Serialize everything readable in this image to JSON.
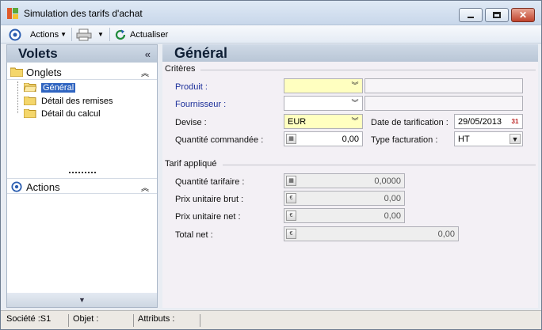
{
  "window": {
    "title": "Simulation des tarifs d'achat",
    "controls": [
      "minimize",
      "maximize",
      "close"
    ]
  },
  "toolbar": {
    "actions_label": "Actions",
    "refresh_label": "Actualiser"
  },
  "left_panel": {
    "title": "Volets",
    "onglets_header": "Onglets",
    "tree": [
      "Général",
      "Détail des remises",
      "Détail du calcul"
    ],
    "selected": "Général",
    "actions_header": "Actions"
  },
  "main": {
    "title": "Général",
    "criteres": {
      "label": "Critères",
      "produit_label": "Produit :",
      "produit_value": "",
      "fournisseur_label": "Fournisseur :",
      "fournisseur_value": "",
      "devise_label": "Devise :",
      "devise_value": "EUR",
      "date_label": "Date de tarification :",
      "date_value": "29/05/2013",
      "quantite_label": "Quantité commandée :",
      "quantite_value": "0,00",
      "type_label": "Type facturation :",
      "type_value": "HT"
    },
    "tarif": {
      "label": "Tarif appliqué",
      "qte_tarifaire_label": "Quantité tarifaire :",
      "qte_tarifaire_value": "0,0000",
      "prix_brut_label": "Prix unitaire brut :",
      "prix_brut_value": "0,00",
      "prix_net_label": "Prix unitaire net :",
      "prix_net_value": "0,00",
      "total_net_label": "Total net :",
      "total_net_value": "0,00"
    }
  },
  "status": {
    "societe": "Société :S1",
    "objet": "Objet :",
    "attributs": "Attributs :"
  },
  "colors": {
    "selection": "#2f64c0",
    "required_field": "#ffffc0",
    "link_label": "#1c2f9a"
  }
}
